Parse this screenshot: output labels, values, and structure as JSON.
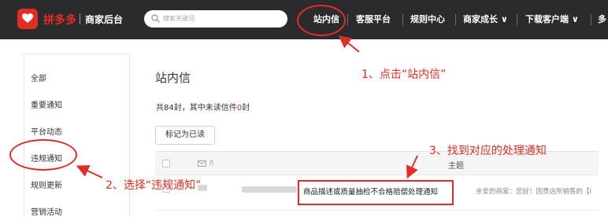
{
  "header": {
    "brand": "拼多多",
    "subtitle": "商家后台",
    "search_placeholder": "搜索关键词",
    "nav": [
      {
        "label": "站内信"
      },
      {
        "label": "客服平台"
      },
      {
        "label": "规则中心"
      },
      {
        "label": "商家成长 ∨"
      },
      {
        "label": "下载客户端 ∨"
      },
      {
        "label": "多"
      }
    ]
  },
  "sidebar": {
    "items": [
      {
        "label": "全部"
      },
      {
        "label": "重要通知"
      },
      {
        "label": "平台动态"
      },
      {
        "label": "违规通知"
      },
      {
        "label": "规则更新"
      },
      {
        "label": "营销活动"
      }
    ]
  },
  "main": {
    "title": "站内信",
    "count_prefix": "共84封，其中未读信件",
    "unread": "0",
    "count_suffix": "封",
    "mark_read_button": "标记为已读",
    "column_subject": "主题",
    "row": {
      "subject": "商品描述或质量抽检不合格赔偿处理通知",
      "preview": "亲爱的商家：您好！因贵店所销售的【I"
    }
  },
  "annotations": {
    "step1": "1、点击“站内信”",
    "step2": "2、选择“违规通知”",
    "step3": "3、找到对应的处理通知"
  },
  "colors": {
    "brand_red": "#e02e24",
    "topbar_bg": "#2b2b2e"
  }
}
